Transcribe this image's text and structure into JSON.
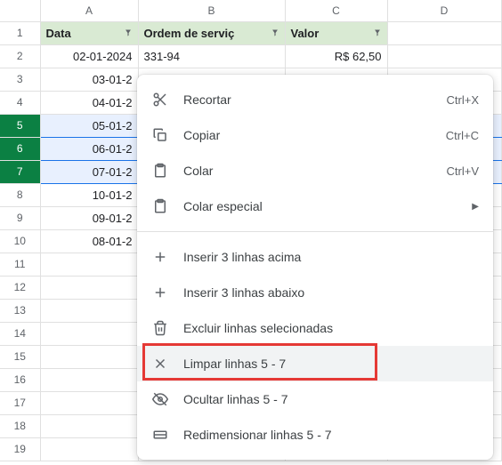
{
  "columns": {
    "a": "A",
    "b": "B",
    "c": "C",
    "d": "D"
  },
  "headers": {
    "data": "Data",
    "ordem": "Ordem de serviç",
    "valor": "Valor"
  },
  "rows": [
    {
      "n": "1"
    },
    {
      "n": "2",
      "a": "02-01-2024",
      "b": "331-94",
      "c": "R$ 62,50"
    },
    {
      "n": "3",
      "a": "03-01-2"
    },
    {
      "n": "4",
      "a": "04-01-2"
    },
    {
      "n": "5",
      "a": "05-01-2"
    },
    {
      "n": "6",
      "a": "06-01-2"
    },
    {
      "n": "7",
      "a": "07-01-2"
    },
    {
      "n": "8",
      "a": "10-01-2"
    },
    {
      "n": "9",
      "a": "09-01-2"
    },
    {
      "n": "10",
      "a": "08-01-2"
    },
    {
      "n": "11"
    },
    {
      "n": "12"
    },
    {
      "n": "13"
    },
    {
      "n": "14"
    },
    {
      "n": "15"
    },
    {
      "n": "16"
    },
    {
      "n": "17"
    },
    {
      "n": "18"
    },
    {
      "n": "19"
    }
  ],
  "menu": {
    "cut": "Recortar",
    "cut_s": "Ctrl+X",
    "copy": "Copiar",
    "copy_s": "Ctrl+C",
    "paste": "Colar",
    "paste_s": "Ctrl+V",
    "paste_sp": "Colar especial",
    "ins_above": "Inserir 3 linhas acima",
    "ins_below": "Inserir 3 linhas abaixo",
    "delete": "Excluir linhas selecionadas",
    "clear": "Limpar linhas 5 - 7",
    "hide": "Ocultar linhas 5 - 7",
    "resize": "Redimensionar linhas 5 - 7"
  }
}
